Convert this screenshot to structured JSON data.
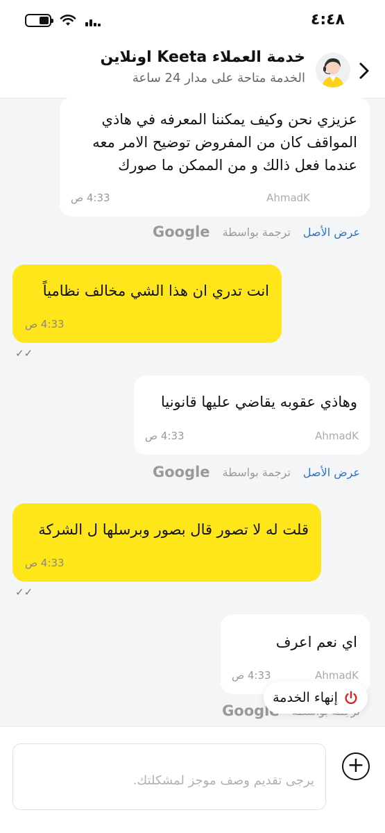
{
  "status_bar": {
    "time": "٤:٤٨",
    "battery_fraction": 0.45
  },
  "header": {
    "title": "خدمة العملاء Keeta اونلاين",
    "subtitle": "الخدمة متاحة على مدار 24 ساعة"
  },
  "translation": {
    "show_original": "عرض الأصل",
    "translated_by": "ترجمة بواسطة",
    "google": "Google"
  },
  "messages": [
    {
      "direction": "in",
      "lines": [
        "عزيزي نحن وكيف يمكننا المعرفه في هاذي",
        "المواقف كان من المفروض توضيح الامر معه",
        "عندما فعل ذالك و من الممكن ما صورك"
      ],
      "sender": "AhmadK",
      "time": "4:33 ص"
    },
    {
      "direction": "out",
      "text": "انت تدري ان هذا الشي مخالف نظامياً",
      "time": "4:33 ص",
      "ticks": "✓✓"
    },
    {
      "direction": "in",
      "text": "وهاذي عقوبه يقاضي عليها قانونيا",
      "sender": "AhmadK",
      "time": "4:33 ص"
    },
    {
      "direction": "out",
      "text": "قلت له لا تصور قال بصور وبرسلها ل الشركة",
      "time": "4:33 ص",
      "ticks": "✓✓"
    },
    {
      "direction": "in",
      "text": "اي نعم اعرف",
      "sender": "AhmadK",
      "time": "4:33 ص"
    }
  ],
  "end_service": {
    "label": "إنهاء الخدمة"
  },
  "input": {
    "placeholder": "يرجى تقديم وصف موجز لمشكلتك."
  }
}
